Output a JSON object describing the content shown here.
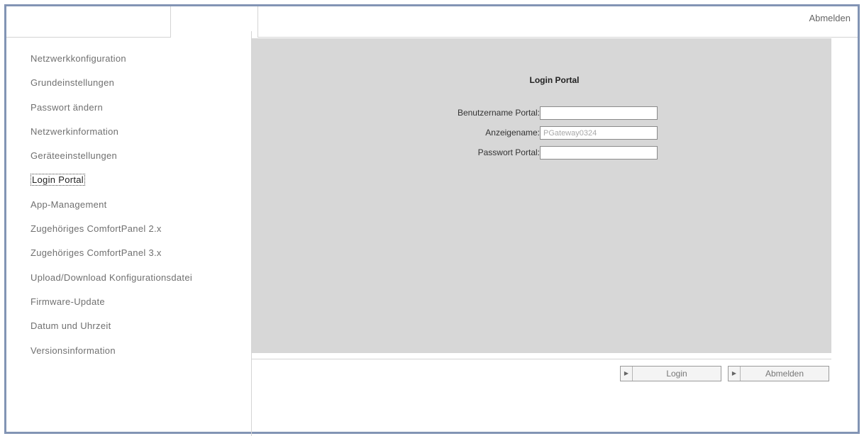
{
  "header": {
    "logout_label": "Abmelden"
  },
  "sidebar": {
    "items": [
      {
        "label": "Netzwerkkonfiguration",
        "name": "sidebar-item-netzwerkkonfiguration"
      },
      {
        "label": "Grundeinstellungen",
        "name": "sidebar-item-grundeinstellungen"
      },
      {
        "label": "Passwort ändern",
        "name": "sidebar-item-passwort-aendern"
      },
      {
        "label": "Netzwerkinformation",
        "name": "sidebar-item-netzwerkinformation"
      },
      {
        "label": "Geräteeinstellungen",
        "name": "sidebar-item-geraeteeinstellungen"
      },
      {
        "label": "Login Portal",
        "name": "sidebar-item-login-portal",
        "active": true
      },
      {
        "label": "App-Management",
        "name": "sidebar-item-app-management"
      },
      {
        "label": "Zugehöriges ComfortPanel 2.x",
        "name": "sidebar-item-comfortpanel-2x"
      },
      {
        "label": "Zugehöriges ComfortPanel 3.x",
        "name": "sidebar-item-comfortpanel-3x"
      },
      {
        "label": "Upload/Download Konfigurationsdatei",
        "name": "sidebar-item-upload-download"
      },
      {
        "label": "Firmware-Update",
        "name": "sidebar-item-firmware-update"
      },
      {
        "label": "Datum und Uhrzeit",
        "name": "sidebar-item-datum-uhrzeit"
      },
      {
        "label": "Versionsinformation",
        "name": "sidebar-item-versionsinformation"
      }
    ]
  },
  "panel": {
    "title": "Login Portal",
    "fields": {
      "username": {
        "label": "Benutzername Portal:",
        "value": ""
      },
      "display_name": {
        "label": "Anzeigename:",
        "value": "PGateway0324"
      },
      "password": {
        "label": "Passwort Portal:",
        "value": ""
      }
    }
  },
  "buttons": {
    "login_label": "Login",
    "logout_label": "Abmelden"
  },
  "colors": {
    "frame_border": "#8294b4",
    "panel_background": "#d7d7d7"
  }
}
